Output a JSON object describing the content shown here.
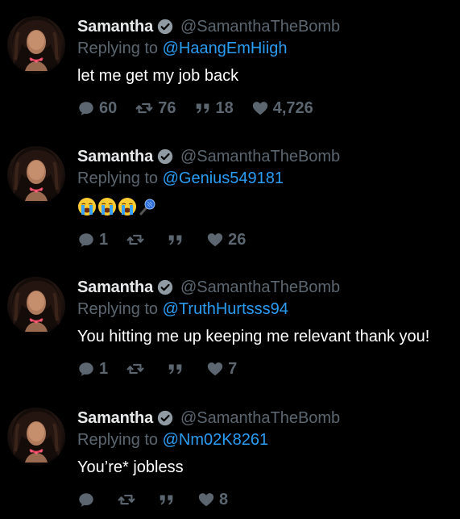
{
  "tweets": [
    {
      "name": "Samantha",
      "handle": "@SamanthaTheBomb",
      "replying_prefix": "Replying to ",
      "replying_to": "@HaangEmHiigh",
      "text": "let me get my job back",
      "replies": "60",
      "retweets": "76",
      "quotes": "18",
      "likes": "4,726"
    },
    {
      "name": "Samantha",
      "handle": "@SamanthaTheBomb",
      "replying_prefix": "Replying to ",
      "replying_to": "@Genius549181",
      "emojis": [
        "crying-face-emoji",
        "crying-face-emoji",
        "crying-face-emoji",
        "microphone-emoji"
      ],
      "replies": "1",
      "retweets": "",
      "quotes": "",
      "likes": "26"
    },
    {
      "name": "Samantha",
      "handle": "@SamanthaTheBomb",
      "replying_prefix": "Replying to ",
      "replying_to": "@TruthHurtsss94",
      "text": "You hitting me up keeping me relevant thank you!",
      "replies": "1",
      "retweets": "",
      "quotes": "",
      "likes": "7"
    },
    {
      "name": "Samantha",
      "handle": "@SamanthaTheBomb",
      "replying_prefix": "Replying to ",
      "replying_to": "@Nm02K8261",
      "text": "You’re* jobless",
      "replies": "",
      "retweets": "",
      "quotes": "",
      "likes": "8"
    }
  ],
  "colors": {
    "background": "#000000",
    "muted": "#5b6670",
    "link": "#2a9df4",
    "text": "#ffffff"
  }
}
